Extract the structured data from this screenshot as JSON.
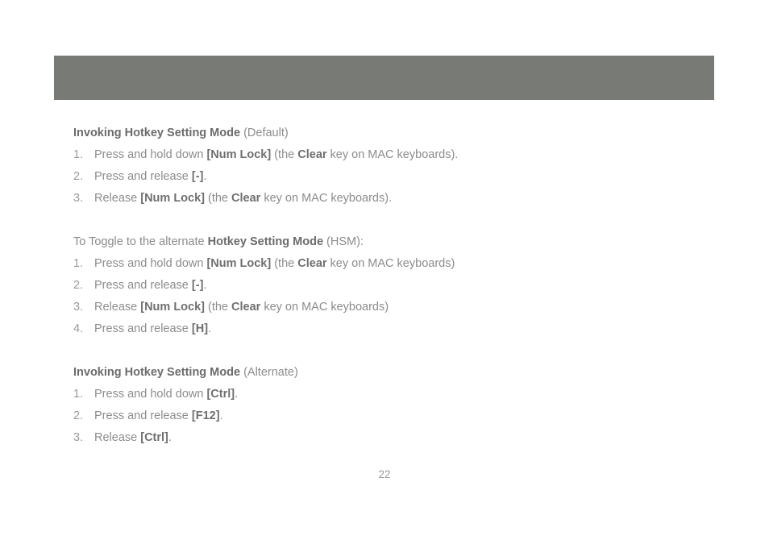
{
  "document": {
    "page_number": "22",
    "header_bar_color": "#787a76",
    "background_color": "#ffffff",
    "body_text_color": "#8c8c8c",
    "bold_text_color": "#6f6f6f"
  },
  "sections": [
    {
      "heading": {
        "bold": "Invoking Hotkey Setting Mode",
        "regular": " (Default)"
      },
      "steps": [
        {
          "number": "1.",
          "parts": [
            {
              "text": "Press and hold down ",
              "bold": false
            },
            {
              "text": "[Num Lock]",
              "bold": true
            },
            {
              "text": " (the ",
              "bold": false
            },
            {
              "text": "Clear",
              "bold": true
            },
            {
              "text": " key on MAC keyboards).",
              "bold": false
            }
          ]
        },
        {
          "number": "2.",
          "parts": [
            {
              "text": "Press and release ",
              "bold": false
            },
            {
              "text": "[-]",
              "bold": true
            },
            {
              "text": ".",
              "bold": false
            }
          ]
        },
        {
          "number": "3.",
          "parts": [
            {
              "text": "Release ",
              "bold": false
            },
            {
              "text": "[Num Lock]",
              "bold": true
            },
            {
              "text": " (the ",
              "bold": false
            },
            {
              "text": "Clear",
              "bold": true
            },
            {
              "text": " key on MAC keyboards).",
              "bold": false
            }
          ]
        }
      ]
    },
    {
      "heading": {
        "regular_lead": "To Toggle to the alternate ",
        "bold": "Hotkey Setting Mode",
        "regular": " (HSM):"
      },
      "steps": [
        {
          "number": "1.",
          "parts": [
            {
              "text": "Press and hold down ",
              "bold": false
            },
            {
              "text": "[Num Lock]",
              "bold": true
            },
            {
              "text": " (the ",
              "bold": false
            },
            {
              "text": "Clear",
              "bold": true
            },
            {
              "text": " key on MAC keyboards)",
              "bold": false
            }
          ]
        },
        {
          "number": "2.",
          "parts": [
            {
              "text": "Press and release ",
              "bold": false
            },
            {
              "text": "[-]",
              "bold": true
            },
            {
              "text": ".",
              "bold": false
            }
          ]
        },
        {
          "number": "3.",
          "parts": [
            {
              "text": "Release ",
              "bold": false
            },
            {
              "text": "[Num Lock]",
              "bold": true
            },
            {
              "text": " (the ",
              "bold": false
            },
            {
              "text": "Clear",
              "bold": true
            },
            {
              "text": " key on MAC keyboards)",
              "bold": false
            }
          ]
        },
        {
          "number": "4.",
          "parts": [
            {
              "text": "Press and release ",
              "bold": false
            },
            {
              "text": "[H]",
              "bold": true
            },
            {
              "text": ".",
              "bold": false
            }
          ]
        }
      ]
    },
    {
      "heading": {
        "bold": "Invoking Hotkey Setting Mode",
        "regular": " (Alternate)"
      },
      "steps": [
        {
          "number": "1.",
          "parts": [
            {
              "text": "Press and hold down ",
              "bold": false
            },
            {
              "text": "[Ctrl]",
              "bold": true
            },
            {
              "text": ".",
              "bold": false
            }
          ]
        },
        {
          "number": "2.",
          "parts": [
            {
              "text": "Press and release ",
              "bold": false
            },
            {
              "text": "[F12]",
              "bold": true
            },
            {
              "text": ".",
              "bold": false
            }
          ]
        },
        {
          "number": "3.",
          "parts": [
            {
              "text": "Release ",
              "bold": false
            },
            {
              "text": "[Ctrl]",
              "bold": true
            },
            {
              "text": ".",
              "bold": false
            }
          ]
        }
      ]
    }
  ]
}
